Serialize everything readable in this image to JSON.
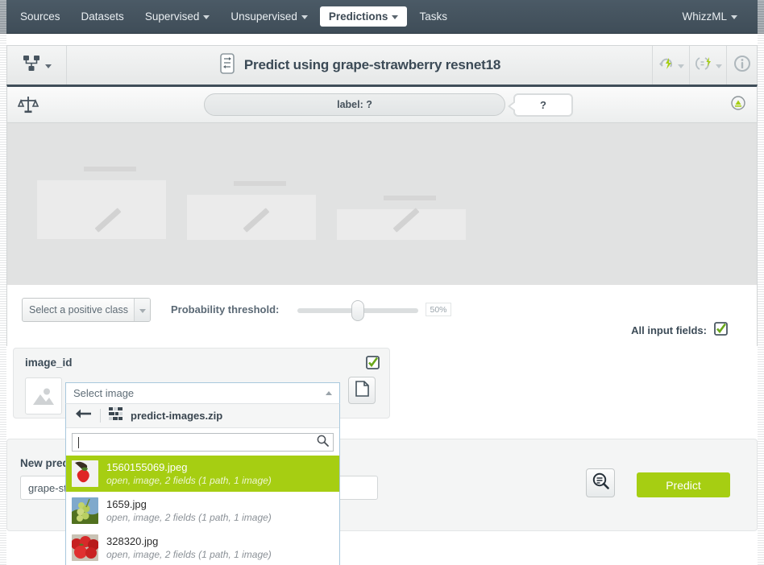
{
  "topnav": {
    "items": [
      {
        "label": "Sources",
        "has_caret": false,
        "active": false
      },
      {
        "label": "Datasets",
        "has_caret": false,
        "active": false
      },
      {
        "label": "Supervised",
        "has_caret": true,
        "active": false
      },
      {
        "label": "Unsupervised",
        "has_caret": true,
        "active": false
      },
      {
        "label": "Predictions",
        "has_caret": true,
        "active": true
      },
      {
        "label": "Tasks",
        "has_caret": false,
        "active": false
      }
    ],
    "right_menu": {
      "label": "WhizzML",
      "has_caret": true
    }
  },
  "titlebar": {
    "title": "Predict using grape-strawberry resnet18",
    "left_menu_icon": "model-tree-icon",
    "center_icon": "prediction-icon",
    "right_icons": [
      "cloud-lightning-icon",
      "batch-prediction-icon",
      "info-icon"
    ]
  },
  "labelbar": {
    "scale_icon": "balance-scale-icon",
    "pill_text": "label: ?",
    "bubble_text": "?",
    "right_icon": "download-circle-icon"
  },
  "controls": {
    "positive_class_select": {
      "value": "Select a positive class",
      "icon": "chevron-down-icon"
    },
    "threshold_label": "Probability threshold:",
    "threshold_value": "50%",
    "threshold_percent": 50,
    "all_input_fields_label": "All input fields:",
    "all_input_fields_checked": true
  },
  "field_card": {
    "name": "image_id",
    "checked": true,
    "thumbnail_icon": "image-placeholder-icon",
    "file_button_icon": "file-icon"
  },
  "image_dropdown": {
    "header_value": "Select image",
    "header_arrow": "chevron-up-icon",
    "back_icon": "arrow-left-icon",
    "source_icon": "zip-source-icon",
    "source_name": "predict-images.zip",
    "search_value": "",
    "search_icon": "search-icon",
    "items": [
      {
        "name": "1560155069.jpeg",
        "meta": "open, image, 2 fields (1 path, 1 image)",
        "selected": true,
        "thumb": "strawberry-in-hand"
      },
      {
        "name": "1659.jpg",
        "meta": "open, image, 2 fields (1 path, 1 image)",
        "selected": false,
        "thumb": "green-grapes"
      },
      {
        "name": "328320.jpg",
        "meta": "open, image, 2 fields (1 path, 1 image)",
        "selected": false,
        "thumb": "red-strawberries"
      }
    ]
  },
  "bottom_panel": {
    "new_prediction_label": "New prediction",
    "name_input_value": "grape-strawberry resnet18 prediction",
    "magnifier_icon": "inspect-prediction-icon",
    "predict_button_label": "Predict"
  },
  "colors": {
    "accent_green": "#a6ce12",
    "nav_dark": "#3f4d58",
    "text_dark": "#3c4b57",
    "panel_grey": "#f4f5f5",
    "skeleton_grey": "#e1e2e2"
  }
}
